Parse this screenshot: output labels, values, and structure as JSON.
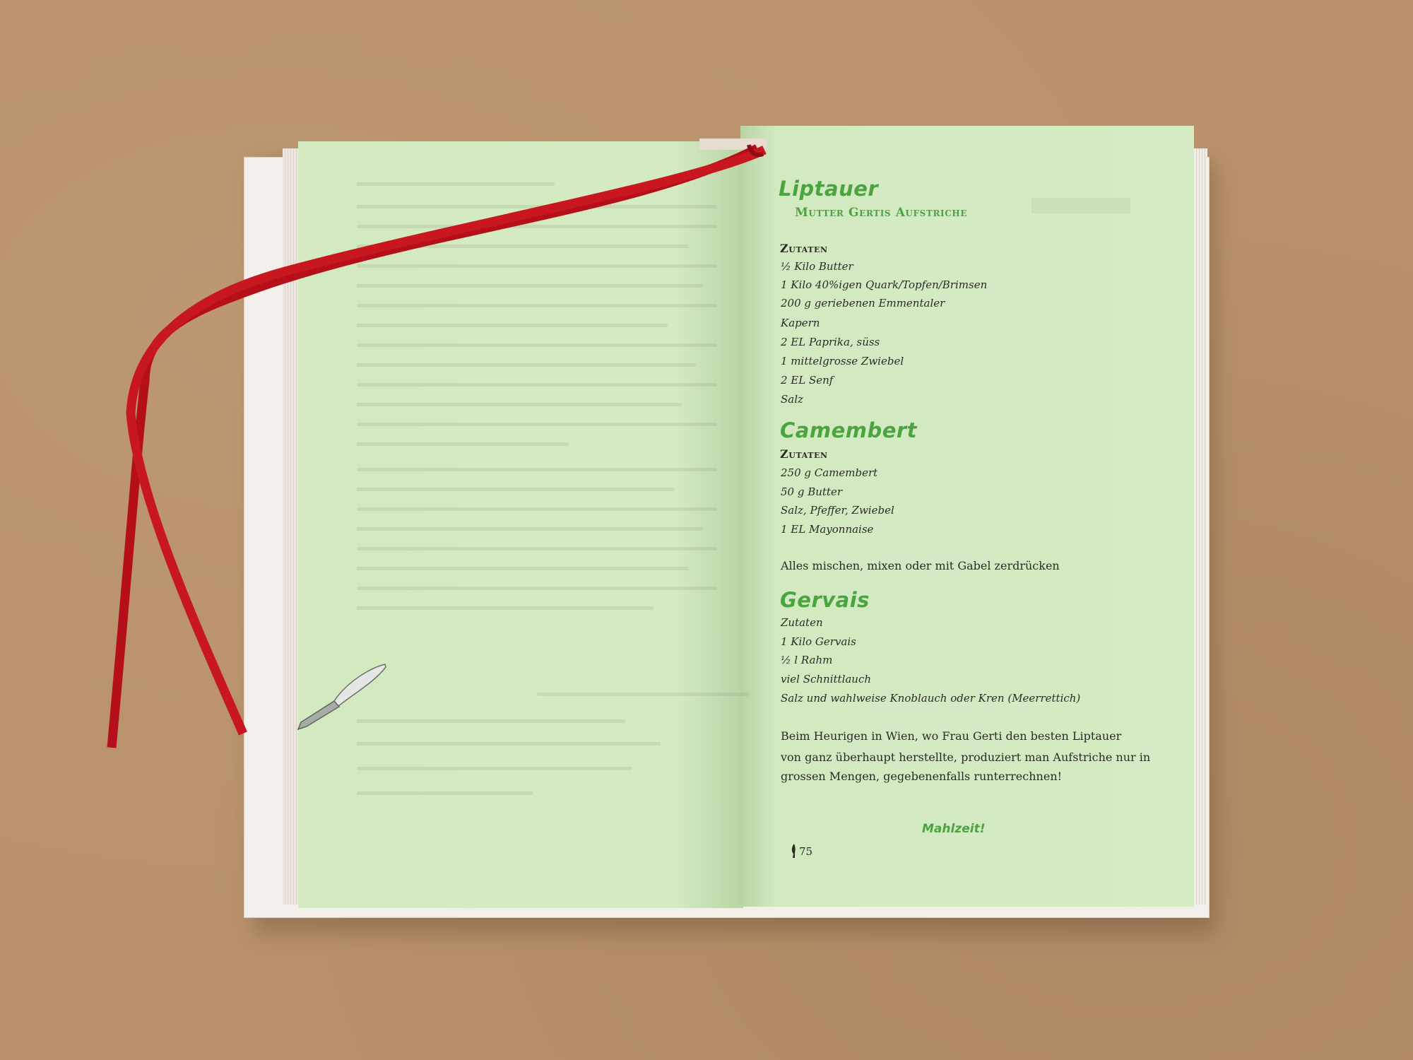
{
  "recipe_page": {
    "title": "Liptauer",
    "subtitle": "Mutter Gertis Aufstriche",
    "liptauer": {
      "section_label": "Zutaten",
      "ingredients": [
        "½ Kilo Butter",
        "1 Kilo 40%igen Quark/Topfen/Brimsen",
        "200 g geriebenen Emmentaler",
        "Kapern",
        "2 EL Paprika, süss",
        "1 mittelgrosse Zwiebel",
        "2 EL Senf",
        "Salz"
      ]
    },
    "camembert": {
      "title": "Camembert",
      "section_label": "Zutaten",
      "ingredients": [
        "250 g Camembert",
        "50 g Butter",
        "Salz, Pfeffer, Zwiebel",
        "1 EL Mayonnaise"
      ],
      "instruction": "Alles mischen, mixen oder mit Gabel zerdrücken"
    },
    "gervais": {
      "title": "Gervais",
      "section_label": "Zutaten",
      "ingredients": [
        "1 Kilo Gervais",
        "½ l Rahm",
        "viel Schnittlauch",
        "Salz und wahlweise Knoblauch oder Kren (Meerrettich)"
      ]
    },
    "note_lines": [
      "Beim Heurigen in Wien, wo Frau Gerti den besten Liptauer",
      "von ganz überhaupt herstellte,  produziert man Aufstriche nur in",
      "grossen Mengen, gegebenenfalls runterrechnen!"
    ],
    "closing": "Mahlzeit!",
    "page_number": "75"
  },
  "colors": {
    "accent_green": "#4aa43f",
    "page_green": "#d4eac2",
    "ribbon_red": "#c4141c",
    "background_kraft": "#b9916a"
  }
}
